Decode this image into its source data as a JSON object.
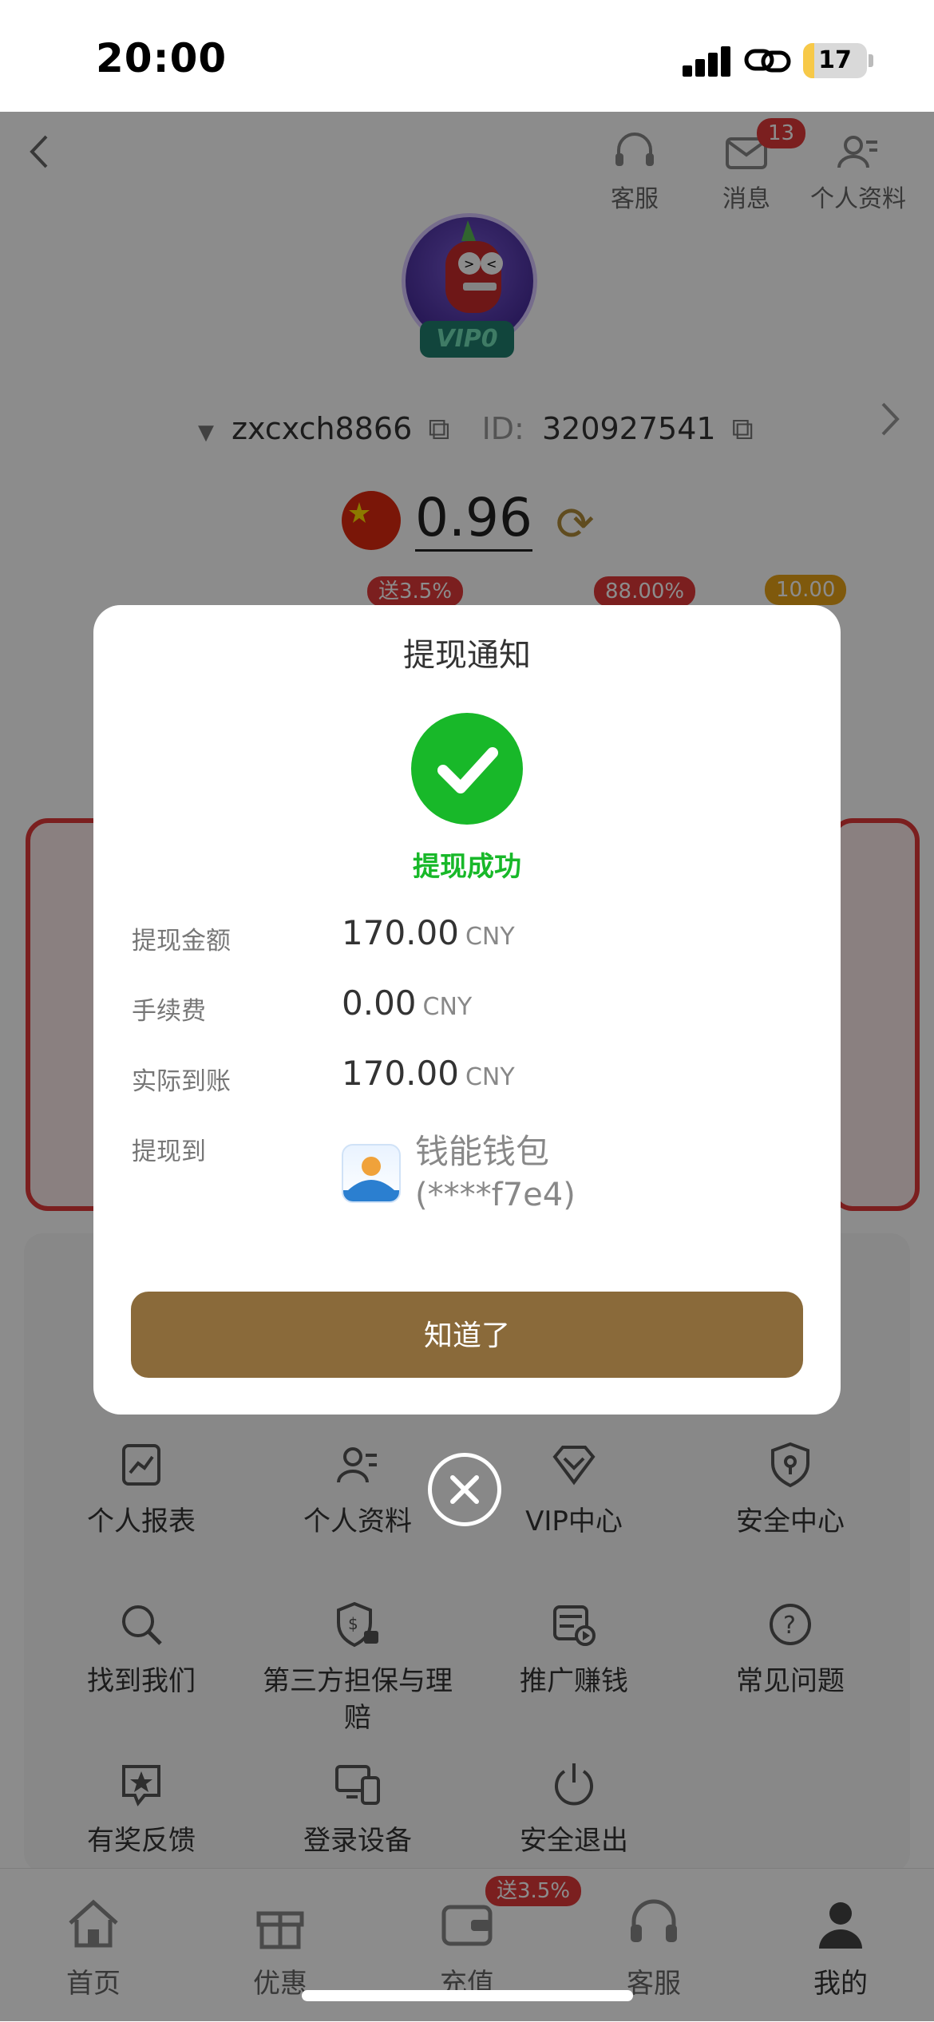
{
  "status_bar": {
    "time": "20:00",
    "battery": "17",
    "battery_level": 0.17
  },
  "header": {
    "service_label": "客服",
    "messages_label": "消息",
    "messages_badge": "13",
    "profile_label": "个人资料"
  },
  "user": {
    "vip_level": "VIP0",
    "username": "zxcxch8866",
    "id_label": "ID:",
    "id_value": "320927541",
    "balance": "0.96"
  },
  "promo_badges": {
    "recharge_bonus": "送3.5%",
    "rate_badge": "88.00%",
    "value_badge": "10.00"
  },
  "modal": {
    "title": "提现通知",
    "status_text": "提现成功",
    "rows": [
      {
        "label": "提现金额",
        "value": "170.00",
        "unit": "CNY"
      },
      {
        "label": "手续费",
        "value": "0.00",
        "unit": "CNY"
      },
      {
        "label": "实际到账",
        "value": "170.00",
        "unit": "CNY"
      }
    ],
    "destination_label": "提现到",
    "wallet_name": "钱能钱包",
    "wallet_address": "(****f7e4)",
    "confirm_label": "知道了"
  },
  "menu": {
    "items": [
      {
        "label": "个人报表",
        "icon": "report-icon"
      },
      {
        "label": "个人资料",
        "icon": "profile-icon"
      },
      {
        "label": "VIP中心",
        "icon": "vip-diamond-icon"
      },
      {
        "label": "安全中心",
        "icon": "shield-icon"
      },
      {
        "label": "找到我们",
        "icon": "search-icon"
      },
      {
        "label": "第三方担保与理赔",
        "icon": "guarantee-icon"
      },
      {
        "label": "推广赚钱",
        "icon": "promote-icon"
      },
      {
        "label": "常见问题",
        "icon": "question-icon"
      },
      {
        "label": "有奖反馈",
        "icon": "feedback-star-icon"
      },
      {
        "label": "登录设备",
        "icon": "devices-icon"
      },
      {
        "label": "安全退出",
        "icon": "power-icon"
      }
    ]
  },
  "tabbar": {
    "tabs": [
      {
        "label": "首页",
        "icon": "home-icon"
      },
      {
        "label": "优惠",
        "icon": "gift-icon"
      },
      {
        "label": "充值",
        "icon": "wallet-icon",
        "badge": "送3.5%"
      },
      {
        "label": "客服",
        "icon": "headset-icon"
      },
      {
        "label": "我的",
        "icon": "user-icon",
        "active": true
      }
    ]
  },
  "colors": {
    "accent": "#8a6a3a",
    "success": "#18b829",
    "badge_red": "#e03a3a",
    "badge_gold": "#e8a317"
  }
}
